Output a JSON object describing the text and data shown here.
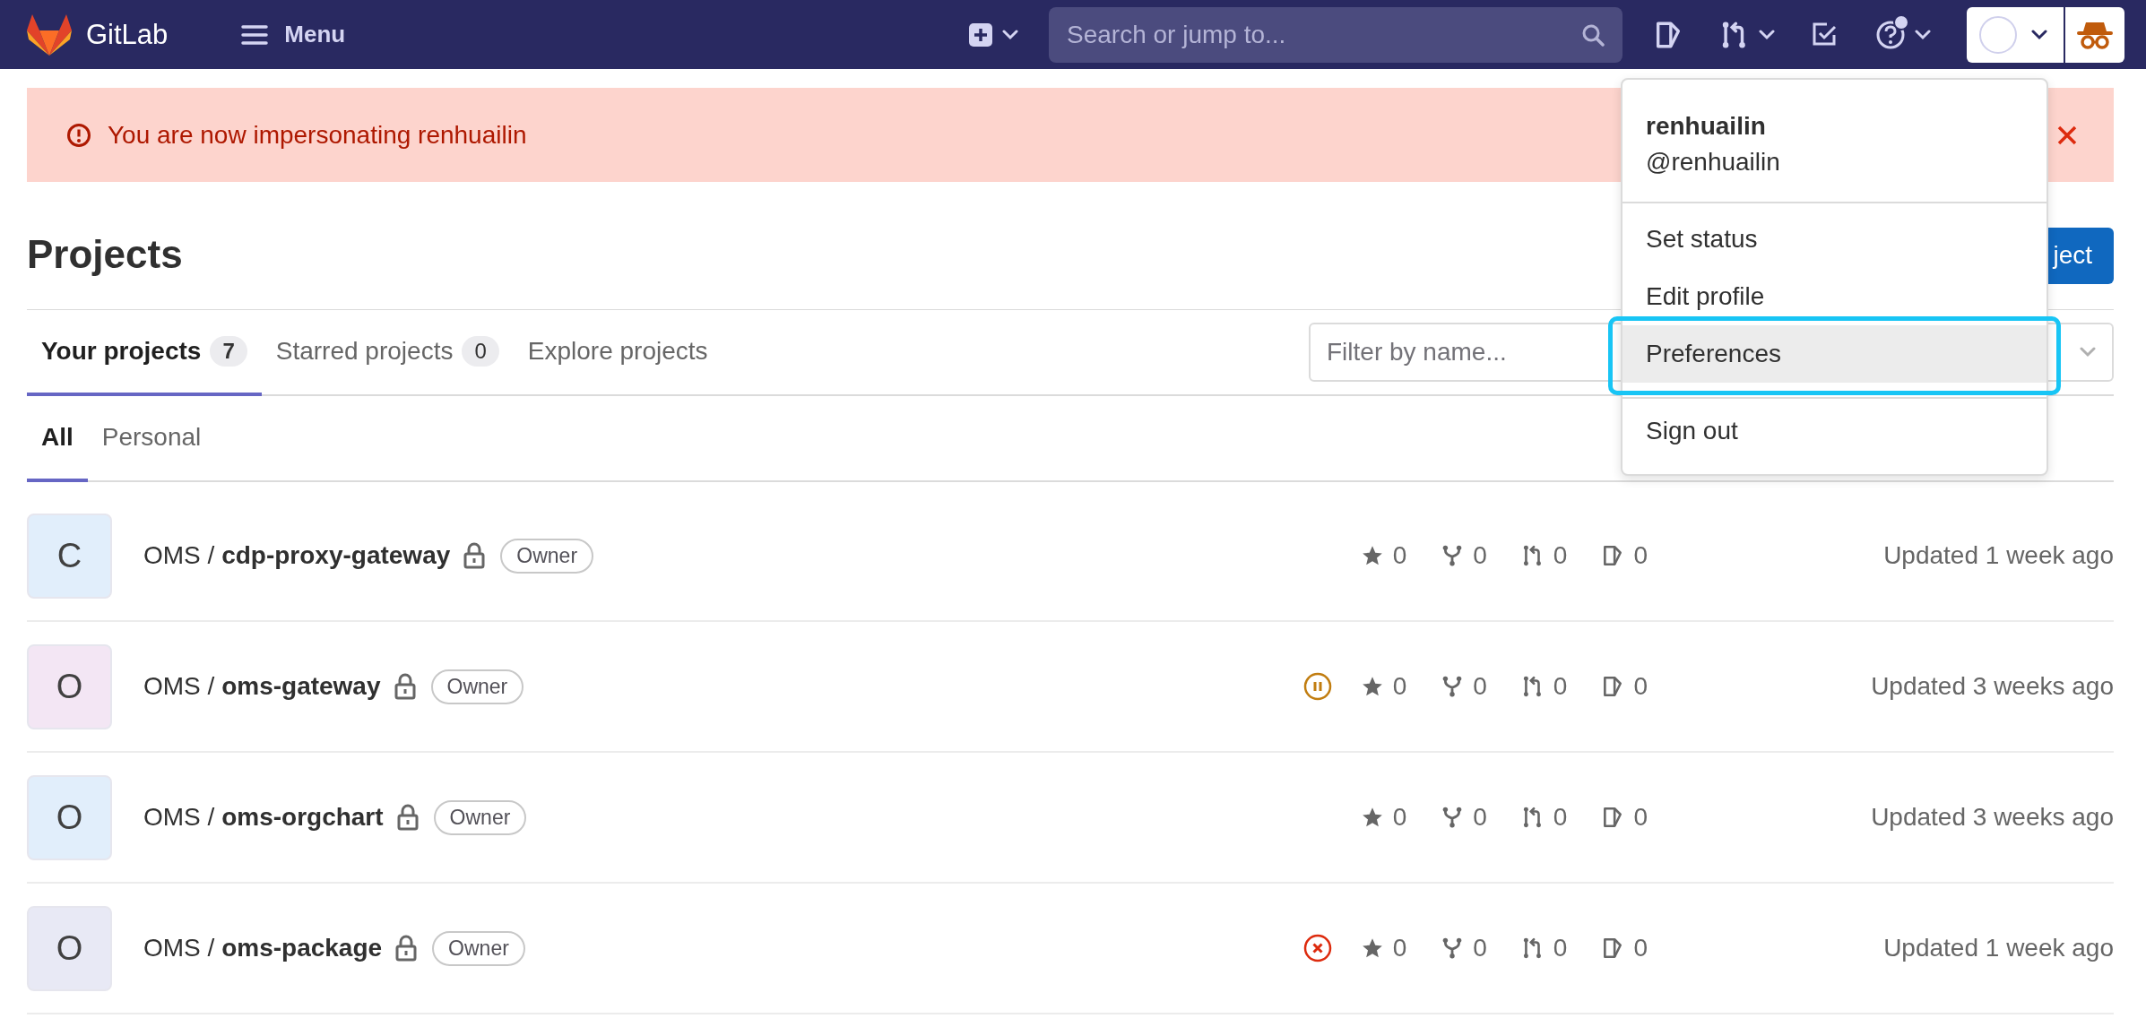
{
  "topbar": {
    "brand": "GitLab",
    "menu_label": "Menu",
    "search": {
      "placeholder": "Search or jump to..."
    },
    "help": {
      "notification": true
    }
  },
  "alert": {
    "message": "You are now impersonating renhuailin"
  },
  "page": {
    "title": "Projects",
    "new_button": "ject"
  },
  "tabs": [
    {
      "label": "Your projects",
      "count": "7",
      "selected": true
    },
    {
      "label": "Starred projects",
      "count": "0",
      "selected": false
    },
    {
      "label": "Explore projects",
      "selected": false
    }
  ],
  "filter": {
    "placeholder": "Filter by name..."
  },
  "subtabs": [
    {
      "label": "All",
      "selected": true
    },
    {
      "label": "Personal",
      "selected": false
    }
  ],
  "projects": [
    {
      "avatar_letter": "C",
      "color": "#e1eefb",
      "path": "OMS / **cdp-proxy-gateway**",
      "role": "Owner",
      "star_count": "0",
      "fork_count": "0",
      "mr_count": "0",
      "issue_count": "0",
      "updated": "Updated 1 week ago"
    },
    {
      "avatar_letter": "O",
      "color": "#f3e6f4",
      "path": "OMS / **oms-gateway**",
      "role": "Owner",
      "pipeline": {
        "kind": "paused"
      },
      "star_count": "0",
      "fork_count": "0",
      "mr_count": "0",
      "issue_count": "0",
      "updated": "Updated 3 weeks ago"
    },
    {
      "avatar_letter": "O",
      "color": "#e1eefb",
      "path": "OMS / **oms-orgchart**",
      "role": "Owner",
      "star_count": "0",
      "fork_count": "0",
      "mr_count": "0",
      "issue_count": "0",
      "updated": "Updated 3 weeks ago"
    },
    {
      "avatar_letter": "O",
      "color": "#e8e9f5",
      "path": "OMS / **oms-package**",
      "role": "Owner",
      "pipeline": {
        "kind": "failed"
      },
      "star_count": "0",
      "fork_count": "0",
      "mr_count": "0",
      "issue_count": "0",
      "updated": "Updated 1 week ago"
    }
  ],
  "user_menu": {
    "name": "renhuailin",
    "username": "@renhuailin",
    "groups": [
      [
        {
          "label": "Set status",
          "highlighted": false
        },
        {
          "label": "Edit profile",
          "highlighted": false
        },
        {
          "label": "Preferences",
          "highlighted": true
        }
      ],
      [
        {
          "label": "Sign out",
          "highlighted": false
        }
      ]
    ]
  }
}
